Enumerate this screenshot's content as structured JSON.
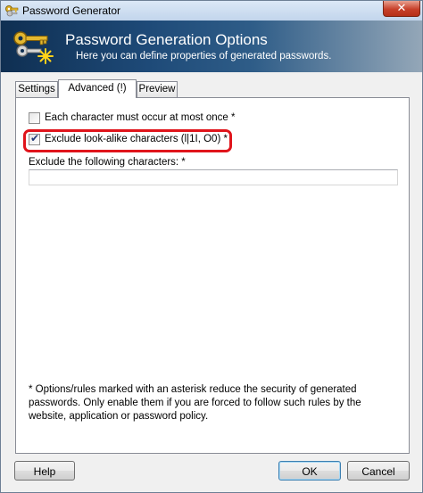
{
  "window": {
    "title": "Password Generator",
    "close_label": "✕"
  },
  "banner": {
    "title": "Password Generation Options",
    "subtitle": "Here you can define properties of generated passwords."
  },
  "tabs": [
    {
      "label": "Settings",
      "active": false
    },
    {
      "label": "Advanced (!)",
      "active": true
    },
    {
      "label": "Preview",
      "active": false
    }
  ],
  "options": {
    "each_once": {
      "label": "Each character must occur at most once *",
      "checked": false
    },
    "exclude_lookalike": {
      "label": "Exclude look-alike characters (l|1I, O0) *",
      "checked": true
    },
    "exclude_chars_label": "Exclude the following characters: *",
    "exclude_chars_value": ""
  },
  "footnote": "* Options/rules marked with an asterisk reduce the security of generated passwords. Only enable them if you are forced to follow such rules by the website, application or password policy.",
  "buttons": {
    "help": "Help",
    "ok": "OK",
    "cancel": "Cancel"
  },
  "colors": {
    "highlight": "#e0141b",
    "banner_dark": "#0f2f52",
    "check": "#243c7a"
  },
  "icons": {
    "app": "keys-icon",
    "banner": "keys-sparkle-icon"
  }
}
